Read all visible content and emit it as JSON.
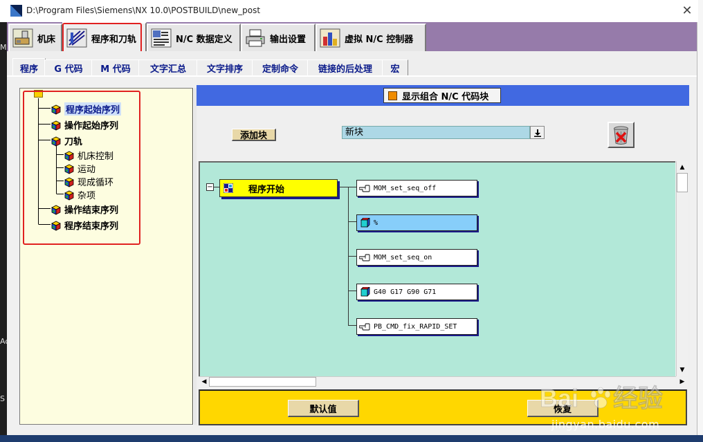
{
  "window": {
    "title": "D:\\Program Files\\Siemens\\NX 10.0\\POSTBUILD\\new_post",
    "close_glyph": "✕"
  },
  "top_tabs": [
    {
      "label": "机床",
      "icon": "machine-tool-icon",
      "active": false
    },
    {
      "label": "程序和刀轨",
      "icon": "program-toolpath-icon",
      "active": true
    },
    {
      "label": "N/C 数据定义",
      "icon": "nc-data-icon",
      "active": false
    },
    {
      "label": "输出设置",
      "icon": "printer-icon",
      "active": false
    },
    {
      "label": "虚拟 N/C 控制器",
      "icon": "virtual-controller-icon",
      "active": false
    }
  ],
  "sub_tabs": [
    {
      "label": "程序",
      "active": true
    },
    {
      "label": "G 代码",
      "active": false
    },
    {
      "label": "M 代码",
      "active": false
    },
    {
      "label": "文字汇总",
      "active": false
    },
    {
      "label": "文字排序",
      "active": false
    },
    {
      "label": "定制命令",
      "active": false
    },
    {
      "label": "链接的后处理",
      "active": false
    },
    {
      "label": "宏",
      "active": false
    }
  ],
  "tree": {
    "items": [
      {
        "label": "程序起始序列",
        "bold": true,
        "selected": true,
        "level": 1
      },
      {
        "label": "操作起始序列",
        "bold": true,
        "selected": false,
        "level": 1
      },
      {
        "label": "刀轨",
        "bold": true,
        "selected": false,
        "level": 1
      },
      {
        "label": "机床控制",
        "bold": false,
        "selected": false,
        "level": 2
      },
      {
        "label": "运动",
        "bold": false,
        "selected": false,
        "level": 2
      },
      {
        "label": "现成循环",
        "bold": false,
        "selected": false,
        "level": 2
      },
      {
        "label": "杂项",
        "bold": false,
        "selected": false,
        "level": 2
      },
      {
        "label": "操作结束序列",
        "bold": true,
        "selected": false,
        "level": 1
      },
      {
        "label": "程序结束序列",
        "bold": true,
        "selected": false,
        "level": 1
      }
    ]
  },
  "panel": {
    "combine_label": "显示组合 N/C 代码块",
    "combine_checked": true,
    "add_block_label": "添加块",
    "block_select_value": "新块",
    "start_block_label": "程序开始",
    "collapse_glyph": "−",
    "blocks": [
      {
        "label": "MOM_set_seq_off",
        "icon": "hand-pointer-icon",
        "selected": false
      },
      {
        "label": "%",
        "icon": "cube-icon",
        "selected": true
      },
      {
        "label": "MOM_set_seq_on",
        "icon": "hand-pointer-icon",
        "selected": false
      },
      {
        "label": "G40 G17 G90 G71",
        "icon": "cube-icon",
        "selected": false
      },
      {
        "label": "PB_CMD_fix_RAPID_SET",
        "icon": "hand-pointer-icon",
        "selected": false
      }
    ],
    "default_button": "默认值",
    "restore_button": "恢复"
  },
  "desktop": {
    "left_labels": [
      "M",
      "Ac",
      "S"
    ]
  },
  "watermark": {
    "brand": "Baidu经验",
    "url": "jingyan.baidu.com"
  },
  "colors": {
    "tab_bar": "#967baa",
    "header_blue": "#4169e1",
    "canvas": "#b2e8d8",
    "bottom_yellow": "#ffd700",
    "tree_bg": "#fdfde0",
    "highlight_red": "#e02020"
  }
}
